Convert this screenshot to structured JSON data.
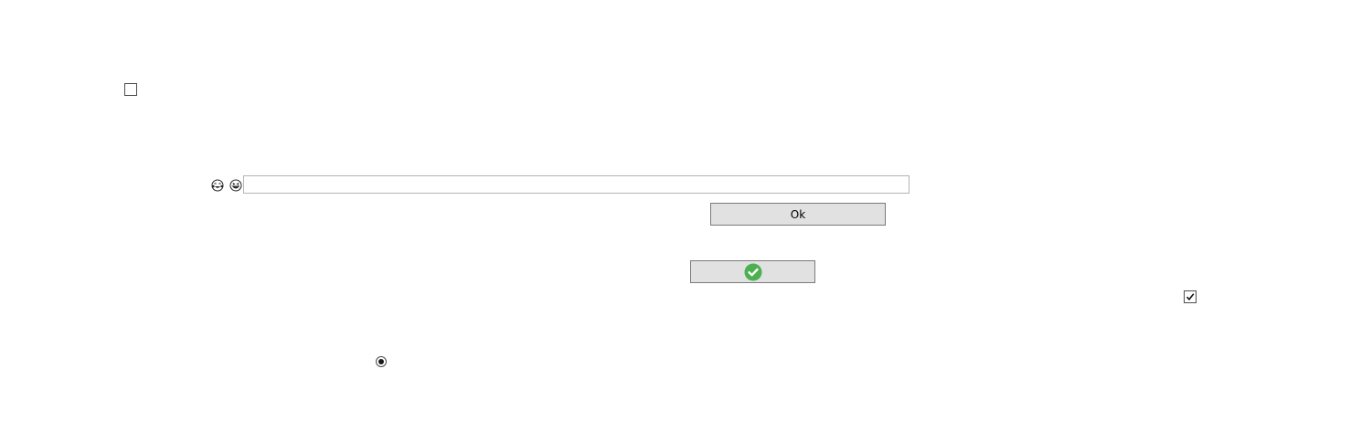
{
  "checkboxes": {
    "top_left": {
      "checked": false
    },
    "right": {
      "checked": true
    }
  },
  "emoji_icons": [
    "tears-of-joy-emoji-icon",
    "grinning-squinting-emoji-icon"
  ],
  "text_input": {
    "value": "",
    "placeholder": ""
  },
  "ok_button": {
    "label": "Ok"
  },
  "check_button": {
    "icon": "green-check-circle-icon",
    "icon_color": "#4caf50"
  },
  "radio": {
    "selected": true
  }
}
